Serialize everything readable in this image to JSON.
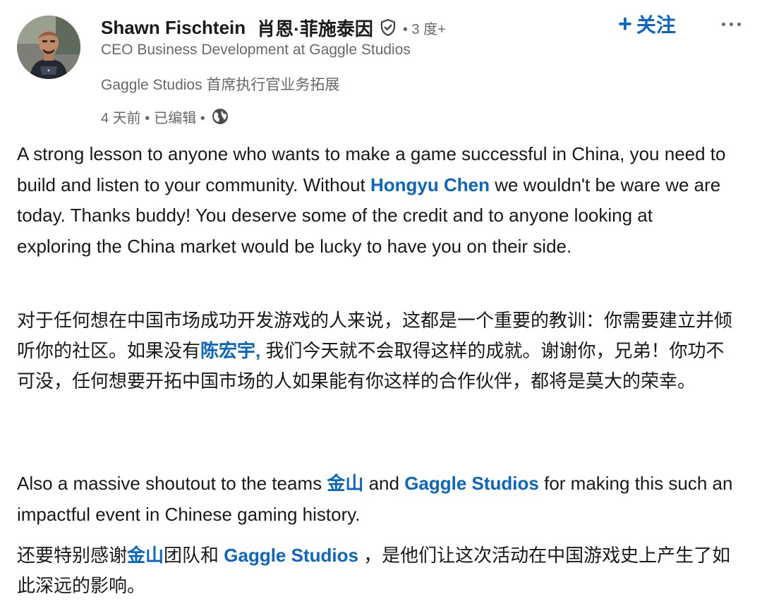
{
  "author": {
    "name": "Shawn Fischtein",
    "name_cn": "肖恩·菲施泰因",
    "degree": "• 3 度+",
    "headline_en": "CEO Business Development at Gaggle Studios",
    "headline_cn": "Gaggle Studios 首席执行官业务拓展",
    "time": "4 天前 •",
    "edited": "已编辑 •",
    "verified_icon": "shield-check-icon",
    "visibility_icon": "globe-icon"
  },
  "actions": {
    "follow_plus": "+",
    "follow_label": "关注",
    "more_icon": "ellipsis-icon"
  },
  "post": {
    "p1": {
      "t1": "A strong lesson to anyone who wants to make a game successful in China, you need to build and listen to your community. Without ",
      "m1": "Hongyu Chen",
      "t2": " we wouldn't be ware we are today. Thanks buddy! You deserve some of the credit and to anyone looking at exploring the China market would be lucky to have you on their side."
    },
    "p2": {
      "t1": "对于任何想在中国市场成功开发游戏的人来说，这都是一个重要的教训：你需要建立并倾听你的社区。如果没有",
      "m1": "陈宏宇,",
      "t2": " 我们今天就不会取得这样的成就。谢谢你，兄弟！你功不可没，任何想要开拓中国市场的人如果能有你这样的合作伙伴，都将是莫大的荣幸。"
    },
    "p3": {
      "t1": "Also a massive shoutout to the teams ",
      "m1": "金山",
      "t2": " and ",
      "m2": "Gaggle Studios",
      "t3": " for making this such an impactful event in Chinese gaming history."
    },
    "p4": {
      "t1": "还要特别感谢",
      "m1": "金山",
      "t2": "团队和 ",
      "m2": "Gaggle Studios",
      "t3": " ，是他们让这次活动在中国游戏史上产生了如此深远的影响。"
    }
  },
  "colors": {
    "link": "#0a66c2",
    "text": "rgba(0,0,0,0.9)",
    "secondary": "rgba(0,0,0,0.6)"
  }
}
